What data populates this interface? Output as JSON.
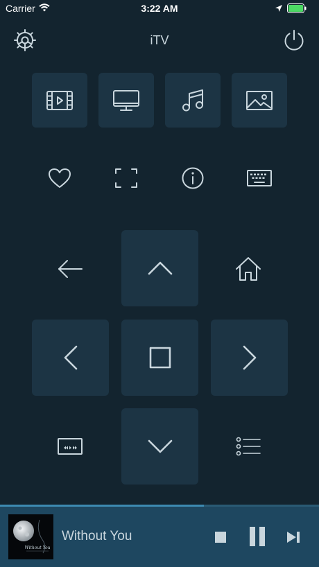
{
  "status_bar": {
    "carrier": "Carrier",
    "time": "3:22 AM"
  },
  "header": {
    "title": "iTV"
  },
  "icons": {
    "settings": "gear-icon",
    "power": "power-icon",
    "video": "film-icon",
    "tv": "monitor-icon",
    "music": "music-note-icon",
    "photo": "image-icon",
    "favorite": "heart-icon",
    "fullscreen": "fullscreen-icon",
    "info": "info-icon",
    "keyboard": "keyboard-icon",
    "back": "arrow-left-icon",
    "home": "home-icon",
    "up": "chevron-up-icon",
    "down": "chevron-down-icon",
    "left": "chevron-left-icon",
    "right": "chevron-right-icon",
    "ok": "square-icon",
    "media_controls": "media-controls-icon",
    "menu": "list-icon",
    "stop": "stop-icon",
    "pause": "pause-icon",
    "next": "skip-next-icon"
  },
  "player": {
    "track_title": "Without You",
    "album_art_text": "Without You",
    "progress": 0.64
  },
  "colors": {
    "background": "#13242f",
    "tile": "#1c3444",
    "foreground": "#c9d6dd",
    "player_bg": "#1e4760",
    "battery": "#4cd964"
  }
}
